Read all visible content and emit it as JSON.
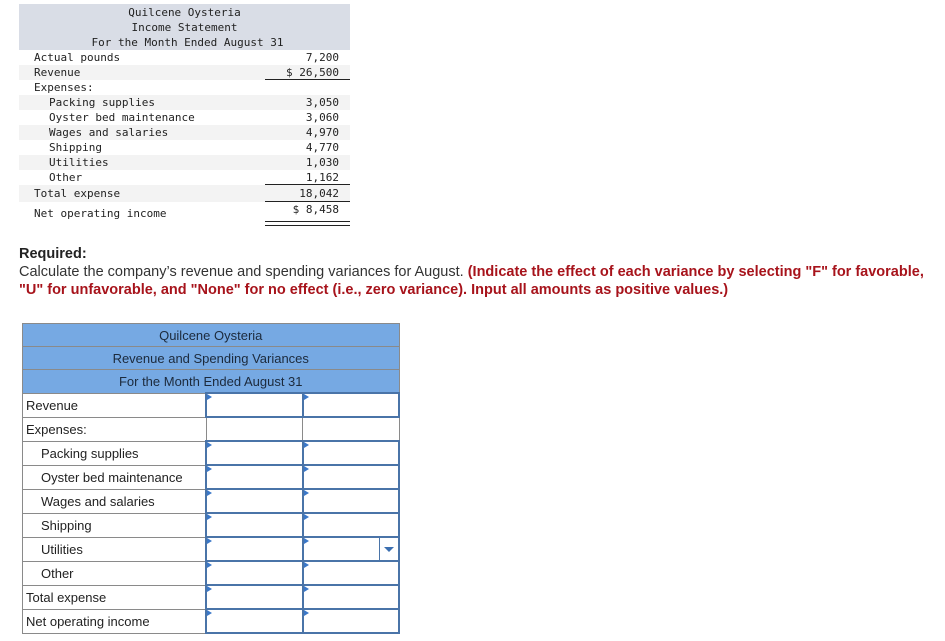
{
  "income_statement": {
    "company": "Quilcene Oysteria",
    "statement": "Income Statement",
    "period": "For the Month Ended August 31",
    "rows": [
      {
        "label": "Actual pounds",
        "value": "7,200"
      },
      {
        "label": "Revenue",
        "value": "$ 26,500"
      },
      {
        "label": "Expenses:",
        "value": ""
      },
      {
        "label": "Packing supplies",
        "value": "3,050"
      },
      {
        "label": "Oyster bed maintenance",
        "value": "3,060"
      },
      {
        "label": "Wages and salaries",
        "value": "4,970"
      },
      {
        "label": "Shipping",
        "value": "4,770"
      },
      {
        "label": "Utilities",
        "value": "1,030"
      },
      {
        "label": "Other",
        "value": "1,162"
      },
      {
        "label": "Total expense",
        "value": "18,042"
      },
      {
        "label": "Net operating income",
        "value": "$ 8,458"
      }
    ]
  },
  "required": {
    "title": "Required:",
    "body": "Calculate the company’s revenue and spending variances for August. ",
    "instruction": "(Indicate the effect of each variance by selecting \"F\" for favorable, \"U\" for unfavorable, and \"None\" for no effect (i.e., zero variance). Input all amounts as positive values.)"
  },
  "variance_table": {
    "company": "Quilcene Oysteria",
    "title": "Revenue and Spending Variances",
    "period": "For the Month Ended August 31",
    "rows": [
      {
        "label": "Revenue",
        "amount": "",
        "effect": ""
      },
      {
        "label": "Expenses:"
      },
      {
        "label": "Packing supplies",
        "amount": "",
        "effect": ""
      },
      {
        "label": "Oyster bed maintenance",
        "amount": "",
        "effect": ""
      },
      {
        "label": "Wages and salaries",
        "amount": "",
        "effect": ""
      },
      {
        "label": "Shipping",
        "amount": "",
        "effect": ""
      },
      {
        "label": "Utilities",
        "amount": "",
        "effect": ""
      },
      {
        "label": "Other",
        "amount": "",
        "effect": ""
      },
      {
        "label": "Total expense",
        "amount": "",
        "effect": ""
      },
      {
        "label": "Net operating income",
        "amount": "",
        "effect": ""
      }
    ]
  },
  "colors": {
    "table_header_bg": "#76a9e3",
    "statement_header_bg": "#d9dde6",
    "instruction_red": "#a7131b",
    "input_border": "#4a74a8"
  }
}
